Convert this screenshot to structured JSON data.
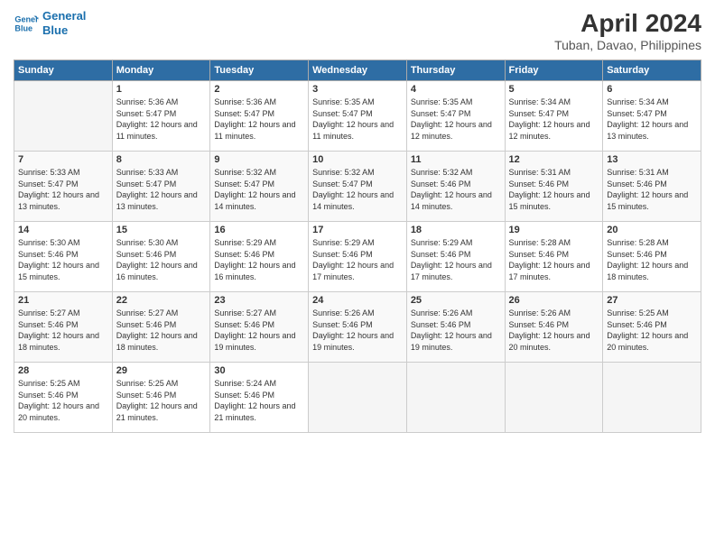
{
  "logo": {
    "line1": "General",
    "line2": "Blue"
  },
  "title": "April 2024",
  "subtitle": "Tuban, Davao, Philippines",
  "days_of_week": [
    "Sunday",
    "Monday",
    "Tuesday",
    "Wednesday",
    "Thursday",
    "Friday",
    "Saturday"
  ],
  "weeks": [
    [
      {
        "day": "",
        "empty": true
      },
      {
        "day": "1",
        "sunrise": "5:36 AM",
        "sunset": "5:47 PM",
        "daylight": "12 hours and 11 minutes."
      },
      {
        "day": "2",
        "sunrise": "5:36 AM",
        "sunset": "5:47 PM",
        "daylight": "12 hours and 11 minutes."
      },
      {
        "day": "3",
        "sunrise": "5:35 AM",
        "sunset": "5:47 PM",
        "daylight": "12 hours and 11 minutes."
      },
      {
        "day": "4",
        "sunrise": "5:35 AM",
        "sunset": "5:47 PM",
        "daylight": "12 hours and 12 minutes."
      },
      {
        "day": "5",
        "sunrise": "5:34 AM",
        "sunset": "5:47 PM",
        "daylight": "12 hours and 12 minutes."
      },
      {
        "day": "6",
        "sunrise": "5:34 AM",
        "sunset": "5:47 PM",
        "daylight": "12 hours and 13 minutes."
      }
    ],
    [
      {
        "day": "7",
        "sunrise": "5:33 AM",
        "sunset": "5:47 PM",
        "daylight": "12 hours and 13 minutes."
      },
      {
        "day": "8",
        "sunrise": "5:33 AM",
        "sunset": "5:47 PM",
        "daylight": "12 hours and 13 minutes."
      },
      {
        "day": "9",
        "sunrise": "5:32 AM",
        "sunset": "5:47 PM",
        "daylight": "12 hours and 14 minutes."
      },
      {
        "day": "10",
        "sunrise": "5:32 AM",
        "sunset": "5:47 PM",
        "daylight": "12 hours and 14 minutes."
      },
      {
        "day": "11",
        "sunrise": "5:32 AM",
        "sunset": "5:46 PM",
        "daylight": "12 hours and 14 minutes."
      },
      {
        "day": "12",
        "sunrise": "5:31 AM",
        "sunset": "5:46 PM",
        "daylight": "12 hours and 15 minutes."
      },
      {
        "day": "13",
        "sunrise": "5:31 AM",
        "sunset": "5:46 PM",
        "daylight": "12 hours and 15 minutes."
      }
    ],
    [
      {
        "day": "14",
        "sunrise": "5:30 AM",
        "sunset": "5:46 PM",
        "daylight": "12 hours and 15 minutes."
      },
      {
        "day": "15",
        "sunrise": "5:30 AM",
        "sunset": "5:46 PM",
        "daylight": "12 hours and 16 minutes."
      },
      {
        "day": "16",
        "sunrise": "5:29 AM",
        "sunset": "5:46 PM",
        "daylight": "12 hours and 16 minutes."
      },
      {
        "day": "17",
        "sunrise": "5:29 AM",
        "sunset": "5:46 PM",
        "daylight": "12 hours and 17 minutes."
      },
      {
        "day": "18",
        "sunrise": "5:29 AM",
        "sunset": "5:46 PM",
        "daylight": "12 hours and 17 minutes."
      },
      {
        "day": "19",
        "sunrise": "5:28 AM",
        "sunset": "5:46 PM",
        "daylight": "12 hours and 17 minutes."
      },
      {
        "day": "20",
        "sunrise": "5:28 AM",
        "sunset": "5:46 PM",
        "daylight": "12 hours and 18 minutes."
      }
    ],
    [
      {
        "day": "21",
        "sunrise": "5:27 AM",
        "sunset": "5:46 PM",
        "daylight": "12 hours and 18 minutes."
      },
      {
        "day": "22",
        "sunrise": "5:27 AM",
        "sunset": "5:46 PM",
        "daylight": "12 hours and 18 minutes."
      },
      {
        "day": "23",
        "sunrise": "5:27 AM",
        "sunset": "5:46 PM",
        "daylight": "12 hours and 19 minutes."
      },
      {
        "day": "24",
        "sunrise": "5:26 AM",
        "sunset": "5:46 PM",
        "daylight": "12 hours and 19 minutes."
      },
      {
        "day": "25",
        "sunrise": "5:26 AM",
        "sunset": "5:46 PM",
        "daylight": "12 hours and 19 minutes."
      },
      {
        "day": "26",
        "sunrise": "5:26 AM",
        "sunset": "5:46 PM",
        "daylight": "12 hours and 20 minutes."
      },
      {
        "day": "27",
        "sunrise": "5:25 AM",
        "sunset": "5:46 PM",
        "daylight": "12 hours and 20 minutes."
      }
    ],
    [
      {
        "day": "28",
        "sunrise": "5:25 AM",
        "sunset": "5:46 PM",
        "daylight": "12 hours and 20 minutes."
      },
      {
        "day": "29",
        "sunrise": "5:25 AM",
        "sunset": "5:46 PM",
        "daylight": "12 hours and 21 minutes."
      },
      {
        "day": "30",
        "sunrise": "5:24 AM",
        "sunset": "5:46 PM",
        "daylight": "12 hours and 21 minutes."
      },
      {
        "day": "",
        "empty": true
      },
      {
        "day": "",
        "empty": true
      },
      {
        "day": "",
        "empty": true
      },
      {
        "day": "",
        "empty": true
      }
    ]
  ]
}
